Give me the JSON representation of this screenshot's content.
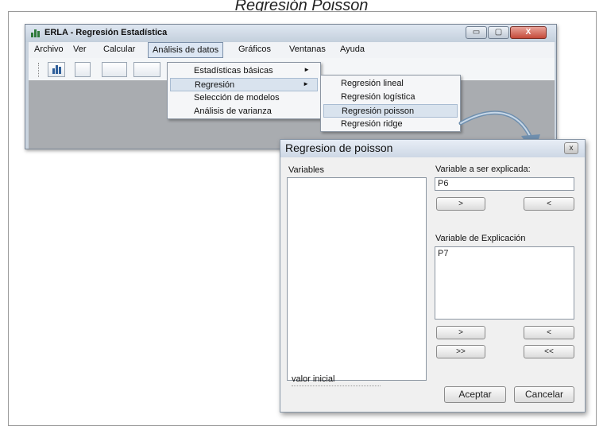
{
  "caption": "Regresión Poisson",
  "app": {
    "title": "ERLA - Regresión Estadística",
    "window_buttons": {
      "minimize": "▭",
      "maximize": "▢",
      "close": "X"
    },
    "menu": [
      "Archivo",
      "Ver",
      "Calcular",
      "Análisis de datos",
      "Gráficos",
      "Ventanas",
      "Ayuda"
    ],
    "active_menu": "Análisis de datos"
  },
  "dropdown_main": {
    "items": [
      {
        "label": "Estadísticas básicas",
        "submenu": true
      },
      {
        "label": "Regresión",
        "submenu": true,
        "highlighted": true
      },
      {
        "label": "Selección de modelos",
        "submenu": false
      },
      {
        "label": "Análisis de varianza",
        "submenu": false
      }
    ],
    "arrow": "►"
  },
  "dropdown_sub": {
    "items": [
      {
        "label": "Regresión lineal"
      },
      {
        "label": "Regresión logística"
      },
      {
        "label": "Regresión poisson",
        "highlighted": true
      },
      {
        "label": "Regresión ridge"
      }
    ]
  },
  "dialog": {
    "title": "Regresion de poisson",
    "close_label": "x",
    "variables_label": "Variables",
    "explained_label": "Variable a ser explicada:",
    "explained_value": "P6",
    "explanatory_label": "Variable de Explicación",
    "explanatory_items": [
      "P7"
    ],
    "buttons": {
      "add_explained": ">",
      "remove_explained": "<",
      "add_one": ">",
      "remove_one": "<",
      "add_all": ">>",
      "remove_all": "<<",
      "accept": "Aceptar",
      "cancel": "Cancelar"
    },
    "initial_value_label": "valor inicial"
  },
  "colors": {
    "accent": "#d9e3ee",
    "window_bg": "#c9d3de",
    "client_bg": "#a9acb0",
    "arrow": "#6f8fae"
  }
}
